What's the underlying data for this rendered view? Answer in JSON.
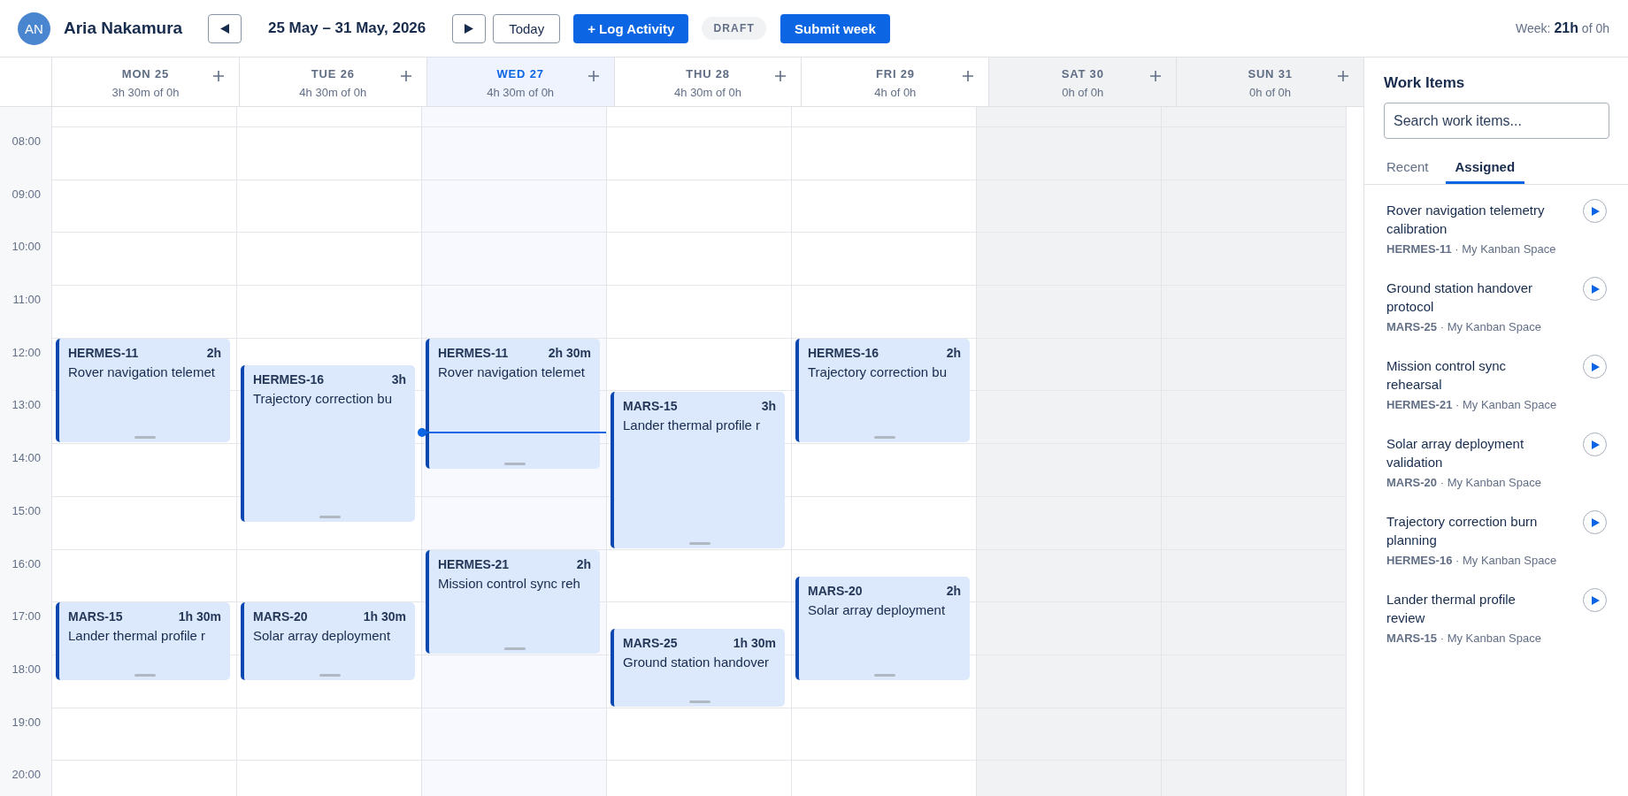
{
  "header": {
    "avatar_initials": "AN",
    "user_name": "Aria Nakamura",
    "date_range": "25 May – 31 May, 2026",
    "today_button": "Today",
    "log_button": "+ Log Activity",
    "status_badge": "DRAFT",
    "submit_button": "Submit week",
    "week_total": "Week: **21h** of 0h"
  },
  "calendar": {
    "hours": [
      "08:00",
      "09:00",
      "10:00",
      "11:00",
      "12:00",
      "13:00",
      "14:00",
      "15:00",
      "16:00",
      "17:00",
      "18:00",
      "19:00",
      "20:00"
    ],
    "days": [
      {
        "label": "MON 25",
        "summary": "3h 30m of 0h",
        "today": false,
        "weekend": false,
        "events": [
          {
            "id": "HERMES-11",
            "duration": "2h",
            "title": "Rover navigation telemet"
          },
          {
            "id": "MARS-15",
            "duration": "1h 30m",
            "title": "Lander thermal profile r"
          }
        ]
      },
      {
        "label": "TUE 26",
        "summary": "4h 30m of 0h",
        "today": false,
        "weekend": false,
        "events": [
          {
            "id": "HERMES-16",
            "duration": "3h",
            "title": "Trajectory correction bu"
          },
          {
            "id": "MARS-20",
            "duration": "1h 30m",
            "title": "Solar array deployment"
          }
        ]
      },
      {
        "label": "WED 27",
        "summary": "4h 30m of 0h",
        "today": true,
        "weekend": false,
        "events": [
          {
            "id": "HERMES-11",
            "duration": "2h 30m",
            "title": "Rover navigation telemet"
          },
          {
            "id": "HERMES-21",
            "duration": "2h",
            "title": "Mission control sync reh"
          }
        ]
      },
      {
        "label": "THU 28",
        "summary": "4h 30m of 0h",
        "today": false,
        "weekend": false,
        "events": [
          {
            "id": "MARS-15",
            "duration": "3h",
            "title": "Lander thermal profile r"
          },
          {
            "id": "MARS-25",
            "duration": "1h 30m",
            "title": "Ground station handover"
          }
        ]
      },
      {
        "label": "FRI 29",
        "summary": "4h of 0h",
        "today": false,
        "weekend": false,
        "events": [
          {
            "id": "HERMES-16",
            "duration": "2h",
            "title": "Trajectory correction bu"
          },
          {
            "id": "MARS-20",
            "duration": "2h",
            "title": "Solar array deployment"
          }
        ]
      },
      {
        "label": "SAT 30",
        "summary": "0h of 0h",
        "today": false,
        "weekend": true
      },
      {
        "label": "SUN 31",
        "summary": "0h of 0h",
        "today": false,
        "weekend": true
      }
    ]
  },
  "sidebar": {
    "title": "Work Items",
    "search": {
      "placeholder": "Search work items..."
    },
    "tabs": [
      {
        "label": "Recent",
        "selected": false
      },
      {
        "label": "Assigned",
        "selected": true
      }
    ],
    "items": [
      {
        "title": "Rover navigation telemetry calibration",
        "meta": "**HERMES-11** · My Kanban Space"
      },
      {
        "title": "Ground station handover protocol",
        "meta": "**MARS-25** · My Kanban Space"
      },
      {
        "title": "Mission control sync rehearsal",
        "meta": "**HERMES-21** · My Kanban Space"
      },
      {
        "title": "Solar array deployment validation",
        "meta": "**MARS-20** · My Kanban Space"
      },
      {
        "title": "Trajectory correction burn planning",
        "meta": "**HERMES-16** · My Kanban Space"
      },
      {
        "title": "Lander thermal profile review",
        "meta": "**MARS-15** · My Kanban Space"
      }
    ]
  }
}
